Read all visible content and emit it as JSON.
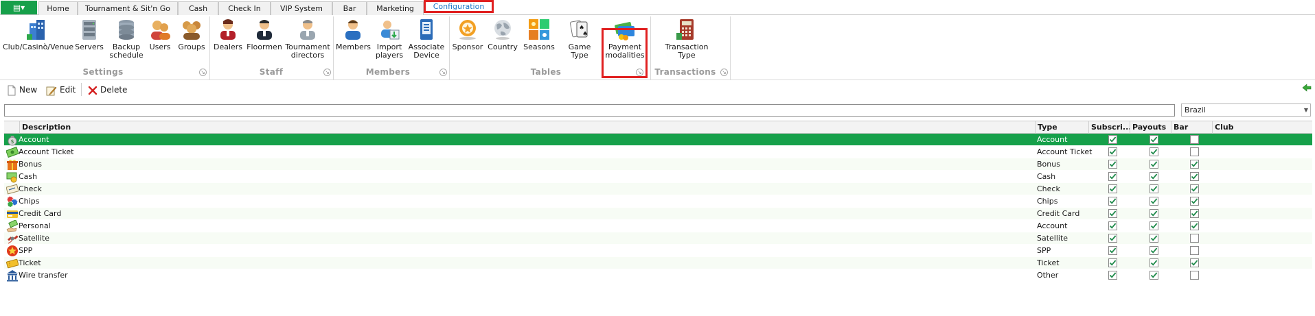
{
  "ribbon": {
    "tabs": [
      {
        "label": "Home",
        "active": false
      },
      {
        "label": "Tournament & Sit'n Go",
        "active": false
      },
      {
        "label": "Cash",
        "active": false
      },
      {
        "label": "Check In",
        "active": false
      },
      {
        "label": "VIP System",
        "active": false
      },
      {
        "label": "Bar",
        "active": false
      },
      {
        "label": "Marketing",
        "active": false
      },
      {
        "label": "Configuration",
        "active": true
      }
    ],
    "buttons": {
      "club": "Club/Casinò/Venue",
      "servers": "Servers",
      "backup_1": "Backup",
      "backup_2": "schedule",
      "users": "Users",
      "groups": "Groups",
      "dealers": "Dealers",
      "floormen": "Floormen",
      "tdirectors_1": "Tournament",
      "tdirectors_2": "directors",
      "members": "Members",
      "import_1": "Import",
      "import_2": "players",
      "associate_1": "Associate",
      "associate_2": "Device",
      "sponsor": "Sponsor",
      "country": "Country",
      "seasons": "Seasons",
      "game_type": "Game Type",
      "payment_1": "Payment",
      "payment_2": "modalities",
      "trans_type_1": "Transaction",
      "trans_type_2": "Type"
    },
    "groups": {
      "settings": "Settings",
      "staff": "Staff",
      "members": "Members",
      "tables": "Tables",
      "transactions": "Transactions"
    }
  },
  "toolbar": {
    "new_label": "New",
    "edit_label": "Edit",
    "delete_label": "Delete"
  },
  "filter": {
    "value": ""
  },
  "country_select": {
    "value": "Brazil"
  },
  "grid": {
    "columns": {
      "description": "Description",
      "type": "Type",
      "subscriptions": "Subscri...",
      "payouts": "Payouts",
      "bar": "Bar",
      "club": "Club"
    },
    "rows": [
      {
        "icon": "money-bag-icon",
        "description": "Account",
        "type": "Account",
        "subscriptions": true,
        "payouts": true,
        "bar": false,
        "selected": true
      },
      {
        "icon": "banknote-icon",
        "description": "Account Ticket",
        "type": "Account Ticket",
        "subscriptions": true,
        "payouts": true,
        "bar": false,
        "selected": false
      },
      {
        "icon": "gift-icon",
        "description": "Bonus",
        "type": "Bonus",
        "subscriptions": true,
        "payouts": true,
        "bar": true,
        "selected": false
      },
      {
        "icon": "cash-icon",
        "description": "Cash",
        "type": "Cash",
        "subscriptions": true,
        "payouts": true,
        "bar": true,
        "selected": false
      },
      {
        "icon": "check-icon",
        "description": "Check",
        "type": "Check",
        "subscriptions": true,
        "payouts": true,
        "bar": true,
        "selected": false
      },
      {
        "icon": "chips-icon",
        "description": "Chips",
        "type": "Chips",
        "subscriptions": true,
        "payouts": true,
        "bar": true,
        "selected": false
      },
      {
        "icon": "credit-card-icon",
        "description": "Credit Card",
        "type": "Credit Card",
        "subscriptions": true,
        "payouts": true,
        "bar": true,
        "selected": false
      },
      {
        "icon": "hand-money-icon",
        "description": "Personal",
        "type": "Account",
        "subscriptions": true,
        "payouts": true,
        "bar": true,
        "selected": false
      },
      {
        "icon": "satellite-icon",
        "description": "Satellite",
        "type": "Satellite",
        "subscriptions": true,
        "payouts": true,
        "bar": false,
        "selected": false
      },
      {
        "icon": "star-icon",
        "description": "SPP",
        "type": "SPP",
        "subscriptions": true,
        "payouts": true,
        "bar": false,
        "selected": false
      },
      {
        "icon": "ticket-icon",
        "description": "Ticket",
        "type": "Ticket",
        "subscriptions": true,
        "payouts": true,
        "bar": true,
        "selected": false
      },
      {
        "icon": "bank-icon",
        "description": "Wire transfer",
        "type": "Other",
        "subscriptions": true,
        "payouts": true,
        "bar": false,
        "selected": false
      }
    ]
  },
  "colors": {
    "accent": "#16a04a",
    "active_tab_text": "#1e78c8",
    "highlight": "#e02020",
    "check": "#1e8a4a"
  }
}
